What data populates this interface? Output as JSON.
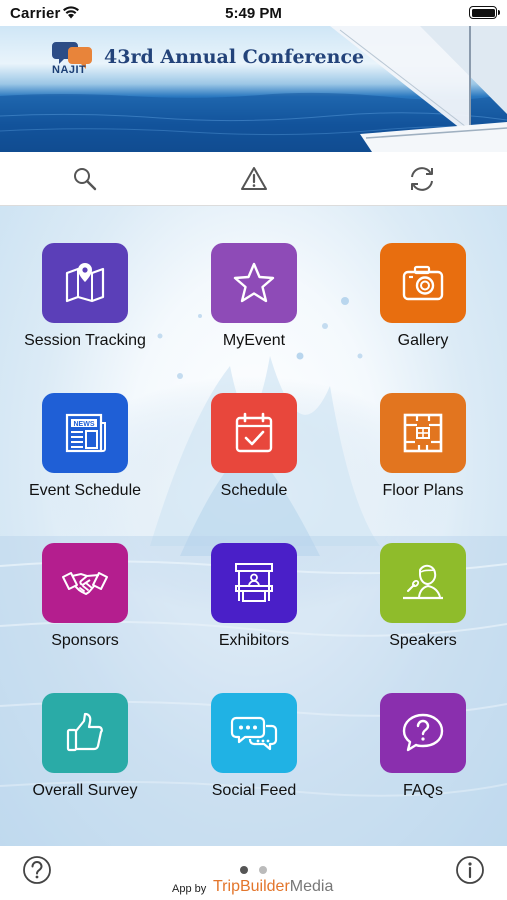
{
  "status_bar": {
    "carrier": "Carrier",
    "time": "5:49 PM",
    "battery_level": 1.0
  },
  "banner": {
    "logo_text": "NAJIT",
    "title": "43rd Annual Conference"
  },
  "toolbar": {
    "items": [
      {
        "icon": "search-icon"
      },
      {
        "icon": "alert-icon"
      },
      {
        "icon": "refresh-icon"
      }
    ]
  },
  "tiles": [
    {
      "label": "Session Tracking",
      "icon": "map-pin-icon",
      "color": "#5b3fb8"
    },
    {
      "label": "MyEvent",
      "icon": "star-icon",
      "color": "#8e4bb7"
    },
    {
      "label": "Gallery",
      "icon": "camera-icon",
      "color": "#e86e0f"
    },
    {
      "label": "Event Schedule",
      "icon": "newspaper-icon",
      "color": "#1f5fd6"
    },
    {
      "label": "Schedule",
      "icon": "calendar-check-icon",
      "color": "#e8473c"
    },
    {
      "label": "Floor Plans",
      "icon": "floor-plan-icon",
      "color": "#e2751f"
    },
    {
      "label": "Sponsors",
      "icon": "handshake-icon",
      "color": "#b41e8e"
    },
    {
      "label": "Exhibitors",
      "icon": "booth-icon",
      "color": "#4a1fc8"
    },
    {
      "label": "Speakers",
      "icon": "speaker-icon",
      "color": "#8fbc2b"
    },
    {
      "label": "Overall Survey",
      "icon": "thumbs-up-icon",
      "color": "#2aaba7"
    },
    {
      "label": "Social Feed",
      "icon": "chat-bubbles-icon",
      "color": "#20b2e4"
    },
    {
      "label": "FAQs",
      "icon": "question-bubble-icon",
      "color": "#8a2fae"
    }
  ],
  "footer": {
    "by_text": "App by",
    "brand_trip": "TripBuilder",
    "brand_media": "Media",
    "page_dots": {
      "count": 2,
      "active": 0
    }
  }
}
